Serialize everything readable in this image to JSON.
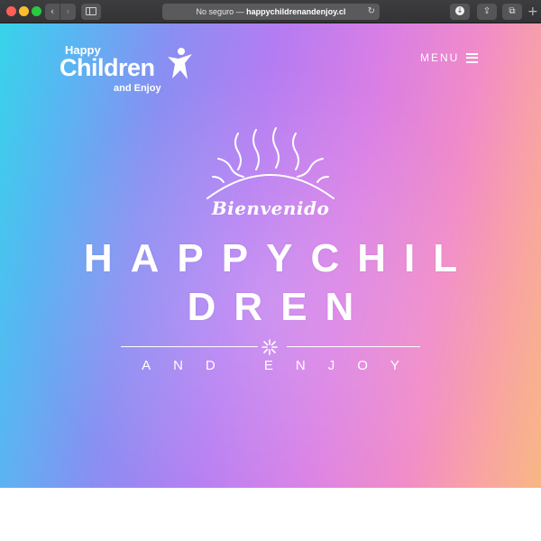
{
  "browser": {
    "url_prefix": "No seguro — ",
    "url_domain": "happychildrenandenjoy.cl",
    "back_glyph": "‹",
    "forward_glyph": "›",
    "reload_glyph": "↻",
    "share_glyph": "⇪",
    "tabs_glyph": "⧉",
    "newtab_glyph": "+"
  },
  "logo": {
    "line1": "Happy",
    "line2": "Children",
    "line3": "and Enjoy"
  },
  "nav": {
    "menu_label": "MENU"
  },
  "hero": {
    "welcome": "Bienvenido",
    "title_line1": "HAPPYCHIL",
    "title_line2": "DREN",
    "subtitle": "AND ENJOY"
  },
  "colors": {
    "gradient": [
      "#37d3ea",
      "#8a8ef2",
      "#d97ee5",
      "#f7b784"
    ],
    "text": "#ffffff"
  },
  "icons": [
    "back-icon",
    "forward-icon",
    "sidebar-icon",
    "reload-icon",
    "download-icon",
    "share-icon",
    "tabs-icon",
    "star-person-icon",
    "hamburger-icon",
    "sun-icon",
    "snowflake-icon"
  ]
}
